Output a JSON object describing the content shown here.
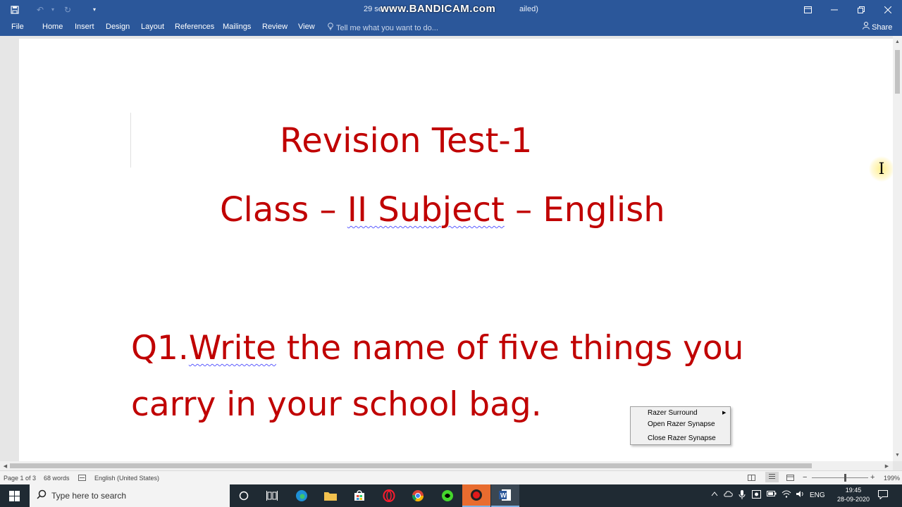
{
  "titlebar": {
    "doc_title": "29 se",
    "doc_title_suffix": "ailed)",
    "watermark": "www.BANDICAM.com",
    "icons": [
      "save-icon",
      "undo-icon",
      "redo-icon",
      "customize-icon"
    ],
    "window_controls": [
      "ribbon-display-icon",
      "minimize-icon",
      "restore-icon",
      "close-icon"
    ]
  },
  "ribbon": {
    "tabs": [
      "File",
      "Home",
      "Insert",
      "Design",
      "Layout",
      "References",
      "Mailings",
      "Review",
      "View"
    ],
    "tell_me": "Tell me what you want to do...",
    "share": "Share"
  },
  "document": {
    "title_line1": "Revision Test-1",
    "title_line2_a": "Class –  ",
    "title_line2_b": "II  Subject",
    "title_line2_c": " – English",
    "q1_line1_a": "Q1.",
    "q1_line1_b": "Write",
    "q1_line1_c": " the name of five things you",
    "q1_line2": "carry in your school bag.",
    "text_color": "#c00000"
  },
  "context_menu": {
    "items": [
      "Razer Surround",
      "Open Razer Synapse",
      "Close Razer Synapse"
    ]
  },
  "statusbar": {
    "page": "Page 1 of 3",
    "words": "68 words",
    "language": "English (United States)",
    "zoom": "199%",
    "zoom_out": "−",
    "zoom_in": "+"
  },
  "taskbar": {
    "search_placeholder": "Type here to search",
    "tray_lang": "ENG",
    "time": "19:45",
    "date": "28-09-2020",
    "apps": [
      "cortana-icon",
      "task-view-icon",
      "edge-icon",
      "file-explorer-icon",
      "store-icon",
      "opera-icon",
      "chrome-icon",
      "razer-icon",
      "bandicam-icon",
      "word-icon"
    ]
  },
  "colors": {
    "word_blue": "#2b579a",
    "doc_red": "#c00000",
    "taskbar": "#1f2a33"
  }
}
